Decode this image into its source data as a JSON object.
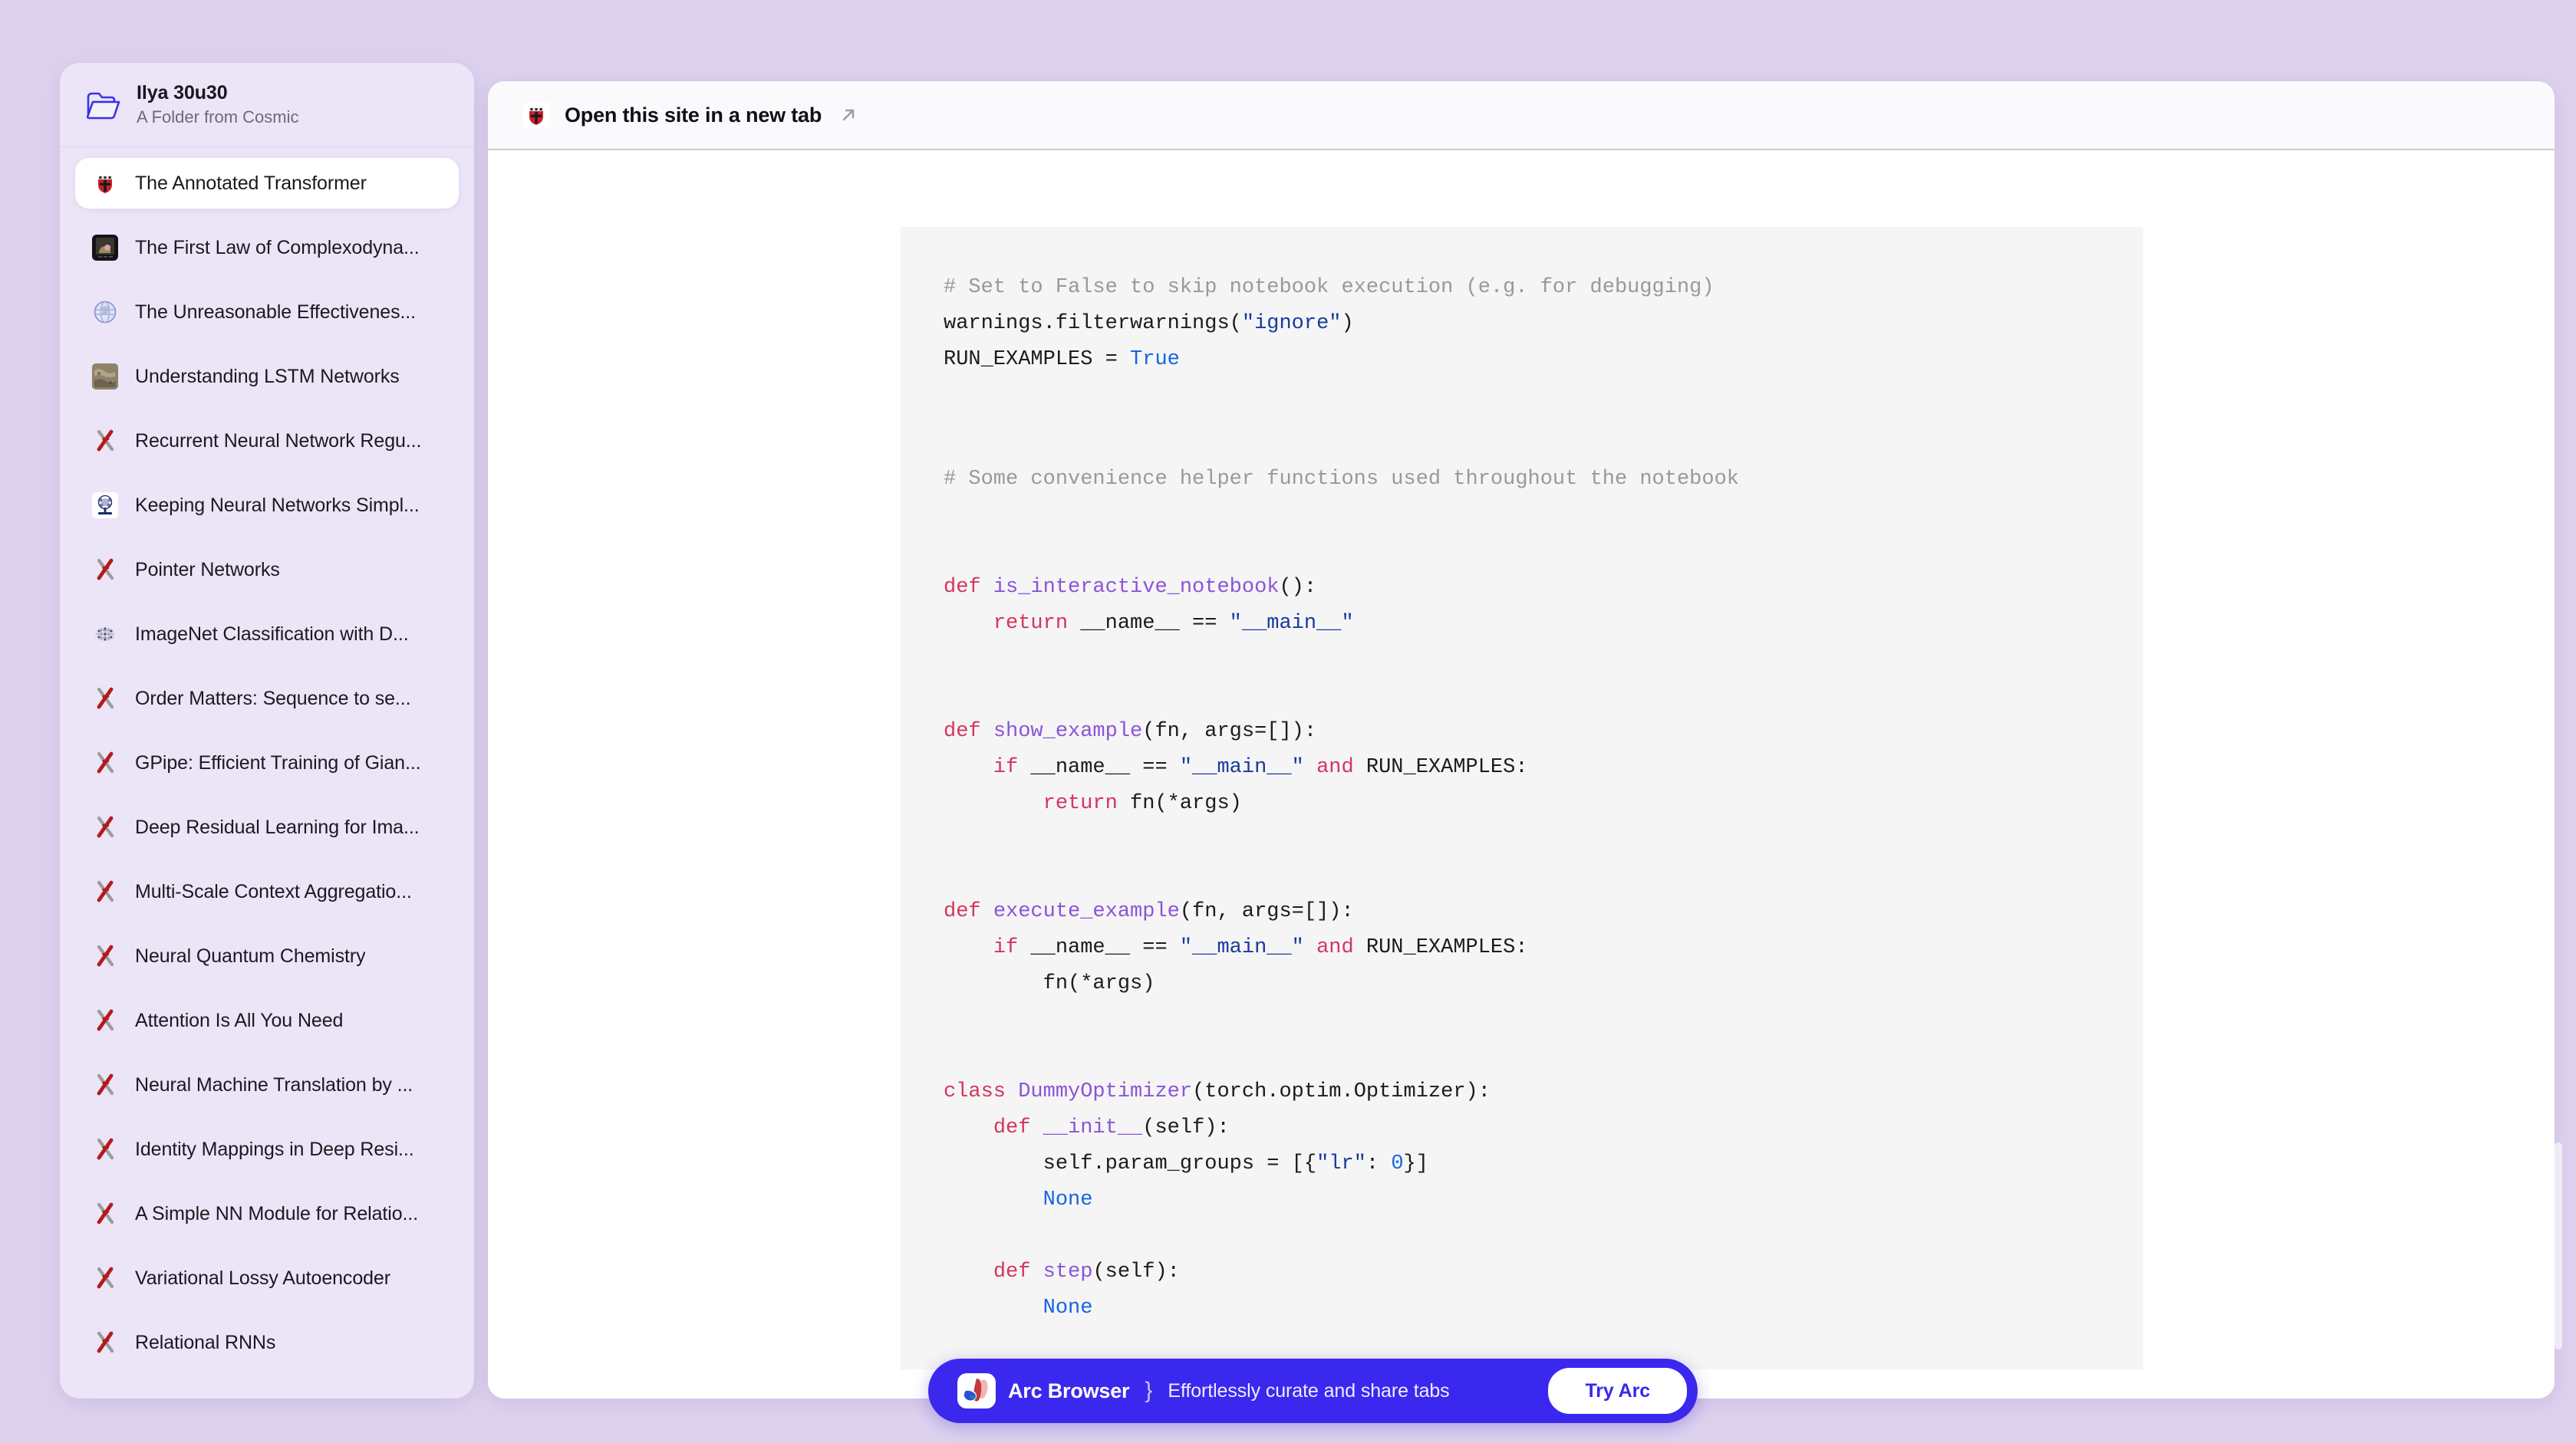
{
  "colors": {
    "page_background": "#ddd2ee",
    "sidebar_background": "#ece4f7",
    "arc_banner_blue": "#3a28ef",
    "code_block_background": "#f5f5f5",
    "keyword_red": "#d4355e",
    "function_purple": "#8a54d8",
    "string_blue": "#1a3a9e",
    "constant_blue": "#1565e0",
    "comment_gray": "#999999"
  },
  "sidebar": {
    "folder": {
      "icon": "open-folder-icon",
      "title": "Ilya 30u30",
      "subtitle": "A Folder from Cosmic"
    },
    "items": [
      {
        "label": "The Annotated Transformer",
        "favicon": "harvard-shield-icon",
        "selected": true
      },
      {
        "label": "The First Law of Complexodyna...",
        "favicon": "photo-thumbnail-icon",
        "selected": false
      },
      {
        "label": "The Unreasonable Effectivenes...",
        "favicon": "globe-icon",
        "selected": false
      },
      {
        "label": "Understanding LSTM Networks",
        "favicon": "texture-thumbnail-icon",
        "selected": false
      },
      {
        "label": "Recurrent Neural Network Regu...",
        "favicon": "arxiv-icon",
        "selected": false
      },
      {
        "label": "Keeping Neural Networks Simpl...",
        "favicon": "university-crest-icon",
        "selected": false
      },
      {
        "label": "Pointer Networks",
        "favicon": "arxiv-icon",
        "selected": false
      },
      {
        "label": "ImageNet Classification with D...",
        "favicon": "neural-net-icon",
        "selected": false
      },
      {
        "label": "Order Matters: Sequence to se...",
        "favicon": "arxiv-icon",
        "selected": false
      },
      {
        "label": "GPipe: Efficient Training of Gian...",
        "favicon": "arxiv-icon",
        "selected": false
      },
      {
        "label": "Deep Residual Learning for Ima...",
        "favicon": "arxiv-icon",
        "selected": false
      },
      {
        "label": "Multi-Scale Context Aggregatio...",
        "favicon": "arxiv-icon",
        "selected": false
      },
      {
        "label": "Neural Quantum Chemistry",
        "favicon": "arxiv-icon",
        "selected": false
      },
      {
        "label": "Attention Is All You Need",
        "favicon": "arxiv-icon",
        "selected": false
      },
      {
        "label": "Neural Machine Translation by ...",
        "favicon": "arxiv-icon",
        "selected": false
      },
      {
        "label": "Identity Mappings in Deep Resi...",
        "favicon": "arxiv-icon",
        "selected": false
      },
      {
        "label": "A Simple NN Module for Relatio...",
        "favicon": "arxiv-icon",
        "selected": false
      },
      {
        "label": "Variational Lossy Autoencoder",
        "favicon": "arxiv-icon",
        "selected": false
      },
      {
        "label": "Relational RNNs",
        "favicon": "arxiv-icon",
        "selected": false
      }
    ]
  },
  "content": {
    "header": {
      "favicon": "harvard-shield-icon",
      "open_in_new_tab_label": "Open this site in a new tab",
      "arrow_icon": "arrow-up-right-icon"
    },
    "code_blocks": [
      {
        "id": "block1",
        "lines": [
          [
            {
              "t": "# Set to False to skip notebook execution (e.g. for debugging)",
              "c": "c-comment"
            }
          ],
          [
            {
              "t": "warnings.filterwarnings(",
              "c": "c-plain"
            },
            {
              "t": "\"ignore\"",
              "c": "c-str"
            },
            {
              "t": ")",
              "c": "c-plain"
            }
          ],
          [
            {
              "t": "RUN_EXAMPLES = ",
              "c": "c-plain"
            },
            {
              "t": "True",
              "c": "c-const"
            }
          ]
        ]
      },
      {
        "id": "block2",
        "lines": [
          [
            {
              "t": "# Some convenience helper functions used throughout the notebook",
              "c": "c-comment"
            }
          ],
          [
            {
              "t": "",
              "c": "c-plain"
            }
          ],
          [
            {
              "t": "",
              "c": "c-plain"
            }
          ],
          [
            {
              "t": "def ",
              "c": "c-kw"
            },
            {
              "t": "is_interactive_notebook",
              "c": "c-fn"
            },
            {
              "t": "():",
              "c": "c-plain"
            }
          ],
          [
            {
              "t": "    ",
              "c": "c-plain"
            },
            {
              "t": "return",
              "c": "c-kw"
            },
            {
              "t": " __name__ == ",
              "c": "c-plain"
            },
            {
              "t": "\"__main__\"",
              "c": "c-str"
            }
          ],
          [
            {
              "t": "",
              "c": "c-plain"
            }
          ],
          [
            {
              "t": "",
              "c": "c-plain"
            }
          ],
          [
            {
              "t": "def ",
              "c": "c-kw"
            },
            {
              "t": "show_example",
              "c": "c-fn"
            },
            {
              "t": "(fn, args=[]):",
              "c": "c-plain"
            }
          ],
          [
            {
              "t": "    ",
              "c": "c-plain"
            },
            {
              "t": "if",
              "c": "c-kw"
            },
            {
              "t": " __name__ == ",
              "c": "c-plain"
            },
            {
              "t": "\"__main__\"",
              "c": "c-str"
            },
            {
              "t": " and ",
              "c": "c-kw"
            },
            {
              "t": "RUN_EXAMPLES:",
              "c": "c-plain"
            }
          ],
          [
            {
              "t": "        ",
              "c": "c-plain"
            },
            {
              "t": "return",
              "c": "c-kw"
            },
            {
              "t": " fn(*args)",
              "c": "c-plain"
            }
          ],
          [
            {
              "t": "",
              "c": "c-plain"
            }
          ],
          [
            {
              "t": "",
              "c": "c-plain"
            }
          ],
          [
            {
              "t": "def ",
              "c": "c-kw"
            },
            {
              "t": "execute_example",
              "c": "c-fn"
            },
            {
              "t": "(fn, args=[]):",
              "c": "c-plain"
            }
          ],
          [
            {
              "t": "    ",
              "c": "c-plain"
            },
            {
              "t": "if",
              "c": "c-kw"
            },
            {
              "t": " __name__ == ",
              "c": "c-plain"
            },
            {
              "t": "\"__main__\"",
              "c": "c-str"
            },
            {
              "t": " and ",
              "c": "c-kw"
            },
            {
              "t": "RUN_EXAMPLES:",
              "c": "c-plain"
            }
          ],
          [
            {
              "t": "        fn(*args)",
              "c": "c-plain"
            }
          ],
          [
            {
              "t": "",
              "c": "c-plain"
            }
          ],
          [
            {
              "t": "",
              "c": "c-plain"
            }
          ],
          [
            {
              "t": "class ",
              "c": "c-kw"
            },
            {
              "t": "DummyOptimizer",
              "c": "c-fn"
            },
            {
              "t": "(torch.optim.Optimizer):",
              "c": "c-plain"
            }
          ],
          [
            {
              "t": "    ",
              "c": "c-plain"
            },
            {
              "t": "def ",
              "c": "c-kw"
            },
            {
              "t": "__init__",
              "c": "c-fn"
            },
            {
              "t": "(self):",
              "c": "c-plain"
            }
          ],
          [
            {
              "t": "        self.param_groups = [{",
              "c": "c-plain"
            },
            {
              "t": "\"lr\"",
              "c": "c-str"
            },
            {
              "t": ": ",
              "c": "c-plain"
            },
            {
              "t": "0",
              "c": "c-num"
            },
            {
              "t": "}]",
              "c": "c-plain"
            }
          ],
          [
            {
              "t": "        ",
              "c": "c-plain"
            },
            {
              "t": "None",
              "c": "c-const"
            }
          ],
          [
            {
              "t": "",
              "c": "c-plain"
            }
          ],
          [
            {
              "t": "    ",
              "c": "c-plain"
            },
            {
              "t": "def ",
              "c": "c-kw"
            },
            {
              "t": "step",
              "c": "c-fn"
            },
            {
              "t": "(self):",
              "c": "c-plain"
            }
          ],
          [
            {
              "t": "        ",
              "c": "c-plain"
            },
            {
              "t": "None",
              "c": "c-const"
            }
          ]
        ]
      }
    ]
  },
  "arc_banner": {
    "logo": "arc-logo-icon",
    "brand": "Arc Browser",
    "separator": "}",
    "tagline": "Effortlessly curate and share tabs",
    "cta_label": "Try Arc"
  }
}
